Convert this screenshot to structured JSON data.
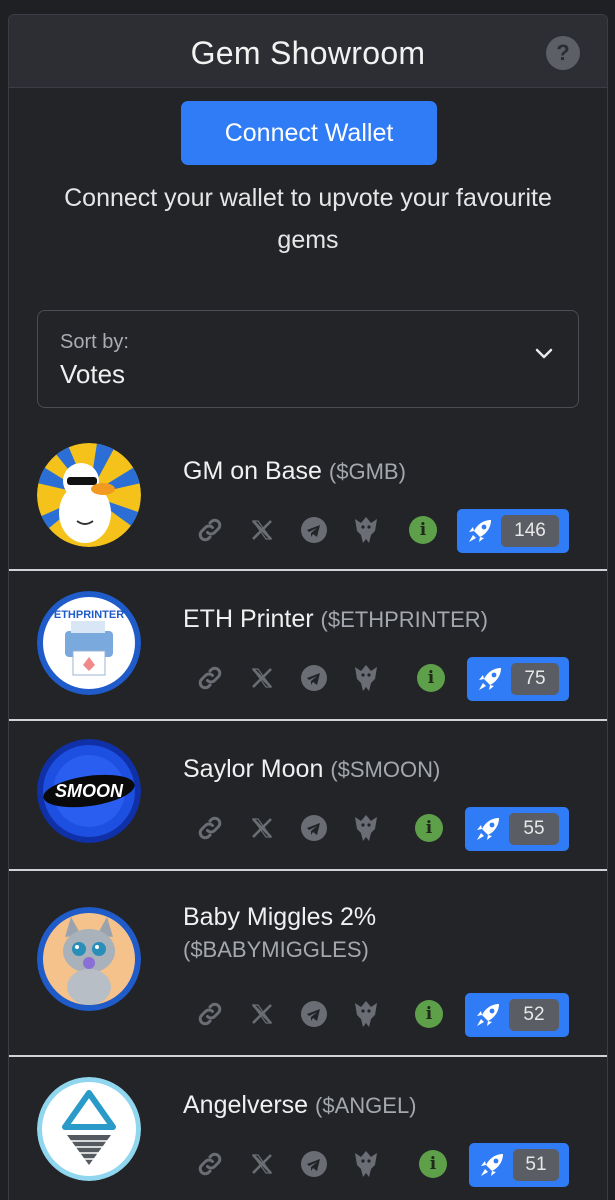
{
  "header": {
    "title": "Gem Showroom",
    "help_glyph": "?"
  },
  "wallet": {
    "connect_label": "Connect Wallet",
    "message": "Connect your wallet to upvote your favourite gems"
  },
  "sort": {
    "label": "Sort by:",
    "value": "Votes"
  },
  "colors": {
    "accent": "#2f7cf6",
    "info": "#5ea04a",
    "count_bg": "#5a5d63"
  },
  "gems": [
    {
      "name": "GM on Base",
      "ticker": "($GMB)",
      "votes": "146",
      "avatar": "duck-avatar"
    },
    {
      "name": "ETH Printer",
      "ticker": "($ETHPRINTER)",
      "votes": "75",
      "avatar": "printer-avatar",
      "avatar_text": "ETHPRINTER"
    },
    {
      "name": "Saylor Moon",
      "ticker": "($SMOON)",
      "votes": "55",
      "avatar": "smoon-coin-avatar",
      "avatar_text": "SMOON"
    },
    {
      "name": "Baby Miggles 2%",
      "ticker": "($BABYMIGGLES)",
      "votes": "52",
      "avatar": "kitten-avatar"
    },
    {
      "name": "Angelverse",
      "ticker": "($ANGEL)",
      "votes": "51",
      "avatar": "triangle-logo-avatar"
    }
  ],
  "icons": [
    "link-icon",
    "x-icon",
    "telegram-icon",
    "eagle-icon",
    "info-icon",
    "rocket-icon",
    "chevron-down-icon",
    "question-icon"
  ]
}
